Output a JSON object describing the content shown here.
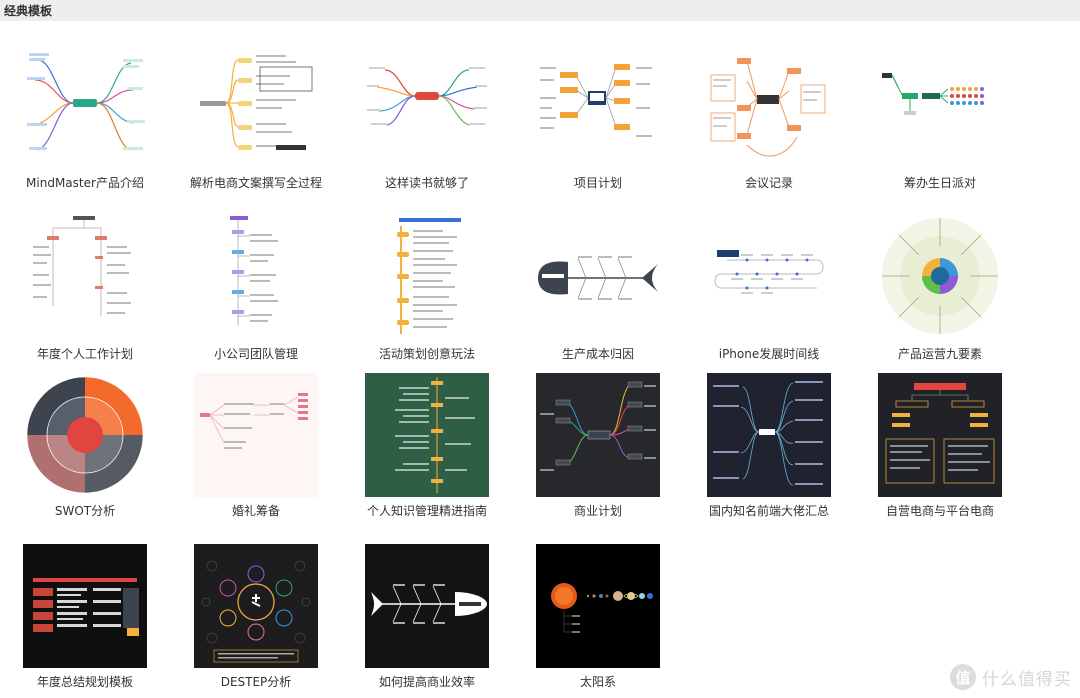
{
  "header": {
    "title": "经典模板"
  },
  "templates": [
    {
      "label": "MindMaster产品介绍",
      "icon": "mindmap-colorful-icon",
      "bg": "#ffffff"
    },
    {
      "label": "解析电商文案撰写全过程",
      "icon": "mindmap-yellow-icon",
      "bg": "#ffffff"
    },
    {
      "label": "这样读书就够了",
      "icon": "mindmap-red-icon",
      "bg": "#ffffff"
    },
    {
      "label": "项目计划",
      "icon": "mindmap-orange-icon",
      "bg": "#ffffff"
    },
    {
      "label": "会议记录",
      "icon": "mindmap-orange-boxes-icon",
      "bg": "#ffffff"
    },
    {
      "label": "筹办生日派对",
      "icon": "mindmap-green-icon",
      "bg": "#ffffff"
    },
    {
      "label": "年度个人工作计划",
      "icon": "tree-chart-icon",
      "bg": "#ffffff"
    },
    {
      "label": "小公司团队管理",
      "icon": "tree-chart-purple-icon",
      "bg": "#ffffff"
    },
    {
      "label": "活动策划创意玩法",
      "icon": "timeline-yellow-icon",
      "bg": "#ffffff"
    },
    {
      "label": "生产成本归因",
      "icon": "fishbone-icon",
      "bg": "#ffffff"
    },
    {
      "label": "iPhone发展时间线",
      "icon": "timeline-icon",
      "bg": "#ffffff"
    },
    {
      "label": "产品运营九要素",
      "icon": "radial-chart-icon",
      "bg": "#ffffff"
    },
    {
      "label": "SWOT分析",
      "icon": "swot-circle-icon",
      "bg": "#ffffff"
    },
    {
      "label": "婚礼筹备",
      "icon": "mindmap-pink-icon",
      "bg": "#fdf6f4"
    },
    {
      "label": "个人知识管理精进指南",
      "icon": "mindmap-green-board-icon",
      "bg": "#2f5e47"
    },
    {
      "label": "商业计划",
      "icon": "mindmap-dark-icon",
      "bg": "#26282c"
    },
    {
      "label": "国内知名前端大佬汇总",
      "icon": "mindmap-navy-icon",
      "bg": "#202230"
    },
    {
      "label": "自营电商与平台电商",
      "icon": "org-chart-dark-icon",
      "bg": "#202228"
    },
    {
      "label": "年度总结规划模板",
      "icon": "table-dark-icon",
      "bg": "#0f0f0f"
    },
    {
      "label": "DESTEP分析",
      "icon": "bubble-map-dark-icon",
      "bg": "#1d1d1f"
    },
    {
      "label": "如何提高商业效率",
      "icon": "fishbone-dark-icon",
      "bg": "#141414"
    },
    {
      "label": "太阳系",
      "icon": "solar-system-icon",
      "bg": "#000000"
    }
  ],
  "watermark": {
    "badge": "值",
    "text": "什么值得买"
  }
}
